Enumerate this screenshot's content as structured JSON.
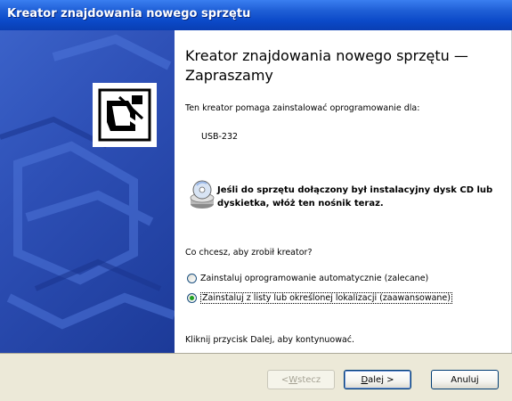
{
  "window": {
    "title": "Kreator znajdowania nowego sprzętu"
  },
  "main": {
    "heading": "Kreator znajdowania nowego sprzętu — Zapraszamy",
    "intro": "Ten kreator pomaga zainstalować oprogramowanie dla:",
    "device_name": "USB-232",
    "cd_message": "Jeśli do sprzętu dołączony był instalacyjny dysk CD lub dyskietka, włóż ten nośnik teraz.",
    "question": "Co chcesz, aby zrobił kreator?",
    "options": [
      {
        "label": "Zainstaluj oprogramowanie automatycznie (zalecane)",
        "selected": false
      },
      {
        "label": "Zainstaluj z listy lub określonej lokalizacji (zaawansowane)",
        "selected": true
      }
    ],
    "continue_hint": "Kliknij przycisk Dalej, aby kontynuować."
  },
  "buttons": {
    "back": {
      "prefix": "< ",
      "accel": "W",
      "rest": "stecz"
    },
    "next": {
      "accel": "D",
      "rest": "alej >"
    },
    "cancel": "Anuluj"
  },
  "colors": {
    "titlebar": "#0b49c8",
    "sidepanel": "#2d4fb5",
    "dialog_bg": "#ece9d8",
    "radio_dot": "#21a121"
  },
  "icons": {
    "wizard": "hardware-wizard-icon",
    "cd": "cd-disk-icon"
  }
}
